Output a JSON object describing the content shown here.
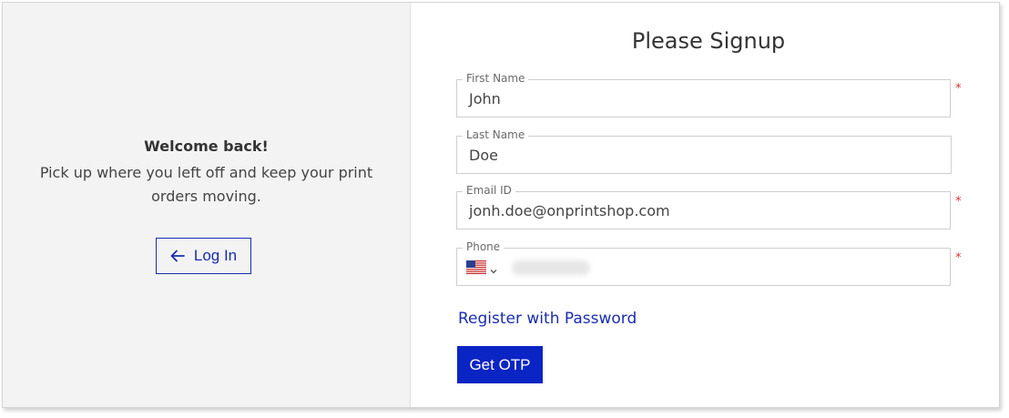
{
  "welcome": {
    "title": "Welcome back!",
    "message": "Pick up where you left off and keep your print orders moving.",
    "login_label": "Log In"
  },
  "form": {
    "title": "Please Signup",
    "required_mark": "*",
    "fields": {
      "first_name": {
        "label": "First Name",
        "value": "John"
      },
      "last_name": {
        "label": "Last Name",
        "value": "Doe"
      },
      "email": {
        "label": "Email ID",
        "value": "jonh.doe@onprintshop.com"
      },
      "phone": {
        "label": "Phone",
        "country": "US"
      }
    },
    "register_link": "Register with Password",
    "otp_button": "Get OTP"
  },
  "icons": {
    "login": "arrow-left-icon",
    "flag": "us-flag-icon",
    "dropdown": "chevron-down-icon"
  },
  "colors": {
    "accent": "#1a2db0",
    "button_bg": "#0b24c4",
    "left_panel_bg": "#f3f3f3",
    "required": "#d0342c"
  }
}
